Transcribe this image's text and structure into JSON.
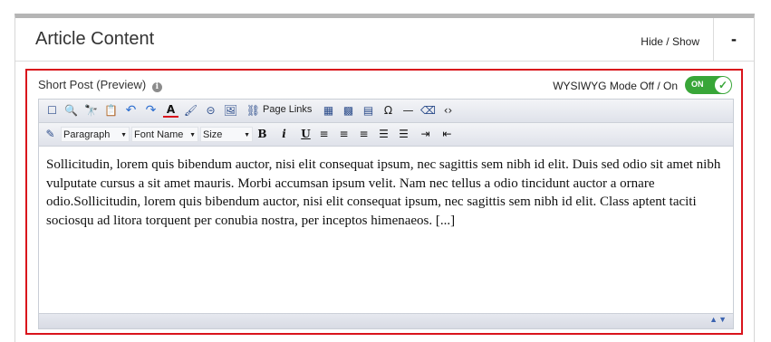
{
  "panel": {
    "title": "Article Content",
    "hide_show_label": "Hide / Show",
    "collapse_symbol": "-"
  },
  "field": {
    "label": "Short Post (Preview)",
    "info_icon": "info-icon",
    "wysiwyg_label": "WYSIWYG Mode Off / On",
    "toggle": {
      "label": "ON",
      "state": "on",
      "check": "✓",
      "color": "#38a638"
    }
  },
  "toolbar": {
    "row1": [
      {
        "name": "select-all-icon",
        "glyph": "☐"
      },
      {
        "name": "find-icon",
        "glyph": "🔍"
      },
      {
        "name": "find-replace-icon",
        "glyph": "🔭"
      },
      {
        "name": "paste-icon",
        "glyph": "📋"
      },
      {
        "name": "undo-icon",
        "glyph": "↶"
      },
      {
        "name": "redo-icon",
        "glyph": "↷"
      },
      {
        "name": "font-color-icon",
        "glyph": "A"
      },
      {
        "name": "highlight-icon",
        "glyph": "🖌"
      },
      {
        "name": "link-icon",
        "glyph": "⊝"
      },
      {
        "name": "image-icon",
        "glyph": "🖼"
      },
      {
        "name": "page-links-icon",
        "glyph": "⛓"
      }
    ],
    "page_links_label": "Page Links",
    "row1b": [
      {
        "name": "table-icon",
        "glyph": "▦"
      },
      {
        "name": "table-edit-icon",
        "glyph": "▩"
      },
      {
        "name": "template-icon",
        "glyph": "▤"
      },
      {
        "name": "omega-icon",
        "glyph": "Ω"
      },
      {
        "name": "horizontal-rule-icon",
        "glyph": "—"
      },
      {
        "name": "eraser-icon",
        "glyph": "⌫"
      },
      {
        "name": "source-code-icon",
        "glyph": "‹›"
      }
    ],
    "style_icon": "✎",
    "paragraph_select": "Paragraph",
    "font_select": "Font Name",
    "size_select": "Size",
    "row2": [
      {
        "name": "bold-icon",
        "glyph": "B"
      },
      {
        "name": "italic-icon",
        "glyph": "i"
      },
      {
        "name": "underline-icon",
        "glyph": "U"
      },
      {
        "name": "align-left-icon",
        "glyph": "≡"
      },
      {
        "name": "align-center-icon",
        "glyph": "≡"
      },
      {
        "name": "align-right-icon",
        "glyph": "≡"
      },
      {
        "name": "ordered-list-icon",
        "glyph": "☰"
      },
      {
        "name": "unordered-list-icon",
        "glyph": "☰"
      },
      {
        "name": "indent-icon",
        "glyph": "⇥"
      },
      {
        "name": "outdent-icon",
        "glyph": "⇤"
      }
    ]
  },
  "content": {
    "text": "Sollicitudin, lorem quis bibendum auctor, nisi elit consequat ipsum, nec sagittis sem nibh id elit. Duis sed odio sit amet nibh vulputate cursus a sit amet mauris. Morbi accumsan ipsum velit. Nam nec tellus a odio tincidunt auctor a ornare odio.Sollicitudin, lorem quis bibendum auctor, nisi elit consequat ipsum, nec sagittis sem nibh id elit. Class aptent taciti sociosqu ad litora torquent per conubia nostra, per inceptos himenaeos. [...]"
  },
  "status_bar": {
    "resize_glyph": "▲▼"
  },
  "colors": {
    "accent_border": "#d9141c",
    "panel_top": "#b5b5b5",
    "toggle_on": "#38a638"
  }
}
